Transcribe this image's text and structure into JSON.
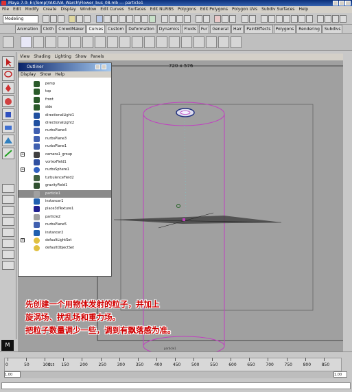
{
  "window": {
    "title": "Maya 7.0: E:\\Temp\\YAKUVA_Warch\\Flower_bus_08.mb    ---    particle1"
  },
  "menubar": [
    "File",
    "Edit",
    "Modify",
    "Create",
    "Display",
    "Window",
    "Edit Curves",
    "Surfaces",
    "Edit NURBS",
    "Polygons",
    "Edit Polygons",
    "Polygon UVs",
    "Subdiv Surfaces",
    "Help"
  ],
  "status_line": {
    "mode": "Modeling"
  },
  "shelf_tabs": [
    "Animation",
    "Cloth",
    "CrowdMaker",
    "Curves",
    "Custom",
    "Deformation",
    "Dynamics",
    "Fluids",
    "Fur",
    "General",
    "Hair",
    "PaintEffects",
    "Polygons",
    "Rendering",
    "Subdivs"
  ],
  "shelf_active": "Curves",
  "panel_menu": [
    "View",
    "Shading",
    "Lighting",
    "Show",
    "Panels"
  ],
  "viewport": {
    "resolution_gate": "720 x 576",
    "object_label": "particle1"
  },
  "outliner": {
    "title": "Outliner",
    "menu": [
      "Display",
      "Show",
      "Help"
    ],
    "items": [
      {
        "label": "persp",
        "icon": "camera-icon"
      },
      {
        "label": "top",
        "icon": "camera-icon"
      },
      {
        "label": "front",
        "icon": "camera-icon"
      },
      {
        "label": "side",
        "icon": "camera-icon"
      },
      {
        "label": "directionalLight1",
        "icon": "directional-light-icon"
      },
      {
        "label": "directionalLight2",
        "icon": "directional-light-icon"
      },
      {
        "label": "nurbsPlane4",
        "icon": "nurbs-surface-icon"
      },
      {
        "label": "nurbsPlane3",
        "icon": "nurbs-surface-icon"
      },
      {
        "label": "nurbsPlane1",
        "icon": "nurbs-surface-icon"
      },
      {
        "label": "camera1_group",
        "icon": "camera-group-icon",
        "expander": "+"
      },
      {
        "label": "vortexField1",
        "icon": "vortex-field-icon"
      },
      {
        "label": "nurbsSphere1",
        "icon": "nurbs-sphere-icon",
        "expander": "+"
      },
      {
        "label": "turbulenceField2",
        "icon": "turbulence-field-icon"
      },
      {
        "label": "gravityField1",
        "icon": "gravity-field-icon"
      },
      {
        "label": "particle1",
        "icon": "particle-icon",
        "selected": true
      },
      {
        "label": "instancer1",
        "icon": "instancer-icon"
      },
      {
        "label": "place3dTexture1",
        "icon": "place3d-texture-icon"
      },
      {
        "label": "particle2",
        "icon": "particle-icon"
      },
      {
        "label": "nurbsPlane5",
        "icon": "nurbs-surface-icon"
      },
      {
        "label": "instancer2",
        "icon": "instancer-icon"
      },
      {
        "label": "defaultLightSet",
        "icon": "set-icon",
        "expander": "+"
      },
      {
        "label": "defaultObjectSet",
        "icon": "set-icon"
      }
    ]
  },
  "caption": {
    "line1": "先创建一个用物体发射的粒子，并加上",
    "line2": "旋涡场、扰乱场和重力场。",
    "line3": "把粒子数量调少一些，调到有飘落感为准。"
  },
  "timeline": {
    "ticks": [
      "0",
      "50",
      "100",
      "150",
      "200",
      "250",
      "300",
      "350",
      "400",
      "450",
      "500",
      "550",
      "600",
      "650",
      "700",
      "750",
      "800",
      "850"
    ],
    "current_frame": "115",
    "start": "1.00",
    "end": "1.00"
  },
  "colors": {
    "selection_magenta": "#c040c0",
    "caption_red": "#d00000",
    "outliner_title_blue": "#0a246a"
  }
}
